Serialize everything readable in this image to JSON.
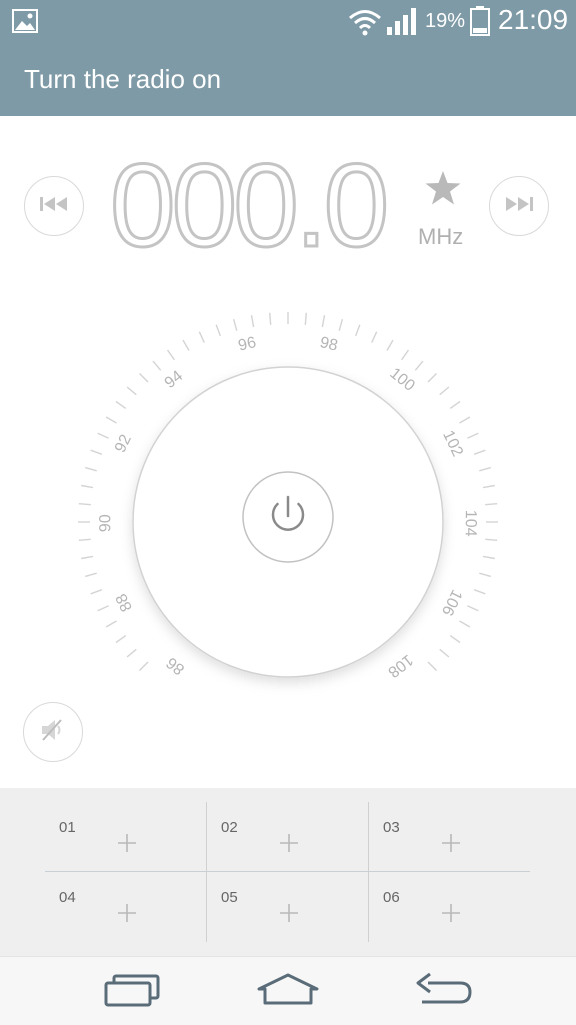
{
  "status_bar": {
    "battery_percent": "19%",
    "time": "21:09",
    "icons": [
      "gallery-icon",
      "wifi-icon",
      "signal-icon",
      "battery-icon"
    ]
  },
  "title_bar": {
    "title": "Turn the radio on"
  },
  "tuner": {
    "frequency": "000.0",
    "unit": "MHz",
    "favorite_icon": "star-icon",
    "prev_icon": "skip-previous-icon",
    "next_icon": "skip-next-icon"
  },
  "dial": {
    "labels": [
      "86",
      "88",
      "90",
      "92",
      "94",
      "96",
      "98",
      "100",
      "102",
      "104",
      "106",
      "108"
    ],
    "power_icon": "power-icon"
  },
  "mute": {
    "icon": "speaker-muted-icon"
  },
  "presets": [
    {
      "num": "01"
    },
    {
      "num": "02"
    },
    {
      "num": "03"
    },
    {
      "num": "04"
    },
    {
      "num": "05"
    },
    {
      "num": "06"
    }
  ],
  "nav_bar": {
    "icons": [
      "recent-apps-icon",
      "home-icon",
      "back-icon"
    ]
  },
  "colors": {
    "header": "#7e9aa6",
    "preset_bg": "#efefef",
    "digits": "#bdbdbd"
  }
}
